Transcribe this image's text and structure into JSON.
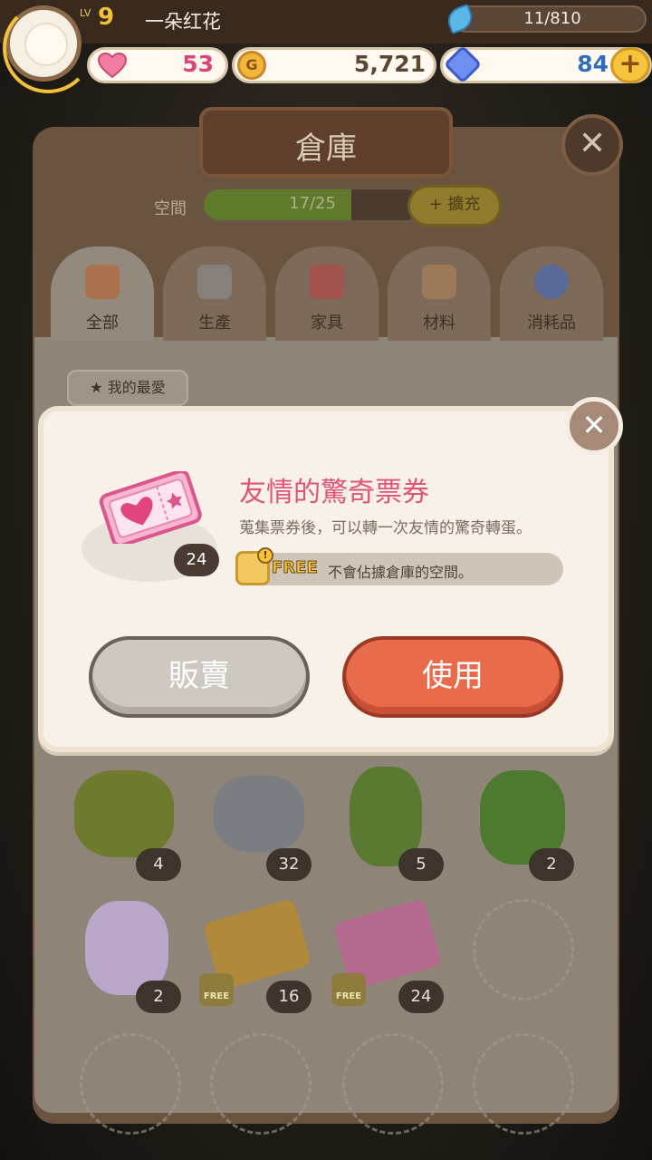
{
  "player": {
    "level_prefix": "LV",
    "level": "9",
    "name": "一朵红花",
    "xp": "11/810"
  },
  "currency": {
    "hearts": "53",
    "coins": "5,721",
    "gems": "84",
    "coin_symbol": "G"
  },
  "warehouse": {
    "title": "倉庫",
    "space_label": "空間",
    "space_value": "17/25",
    "space_fraction": 0.68,
    "expand_label": "擴充",
    "tabs": [
      {
        "label": "全部",
        "icon": "grid-icon",
        "active": true
      },
      {
        "label": "生產",
        "icon": "hammer-icon",
        "active": false
      },
      {
        "label": "家具",
        "icon": "sofa-icon",
        "active": false
      },
      {
        "label": "材料",
        "icon": "log-icon",
        "active": false
      },
      {
        "label": "消耗品",
        "icon": "potion-icon",
        "active": false
      }
    ],
    "favorite_label": "我的最愛",
    "items": [
      {
        "icon": "nut-seeds-icon",
        "count": "4",
        "free": false
      },
      {
        "icon": "stones-icon",
        "count": "32",
        "free": false
      },
      {
        "icon": "sapling-icon",
        "count": "5",
        "free": false
      },
      {
        "icon": "vine-icon",
        "count": "2",
        "free": false
      },
      {
        "icon": "rainbow-jar-icon",
        "count": "2",
        "free": false
      },
      {
        "icon": "gold-ticket-icon",
        "count": "16",
        "free": true
      },
      {
        "icon": "friendship-ticket-icon",
        "count": "24",
        "free": true
      }
    ],
    "free_badge": "FREE"
  },
  "popup": {
    "item_name": "友情的驚奇票券",
    "description": "蒐集票券後，可以轉一次友情的驚奇轉蛋。",
    "quantity": "24",
    "free_label": "FREE",
    "free_note": "不會佔據倉庫的空間。",
    "sell_label": "販賣",
    "use_label": "使用",
    "close_symbol": "✕"
  },
  "colors": {
    "item_name": "#e0547b",
    "use_button": "#e86c4c",
    "sell_button": "#cfc8c1",
    "gold": "#f2c03a"
  }
}
